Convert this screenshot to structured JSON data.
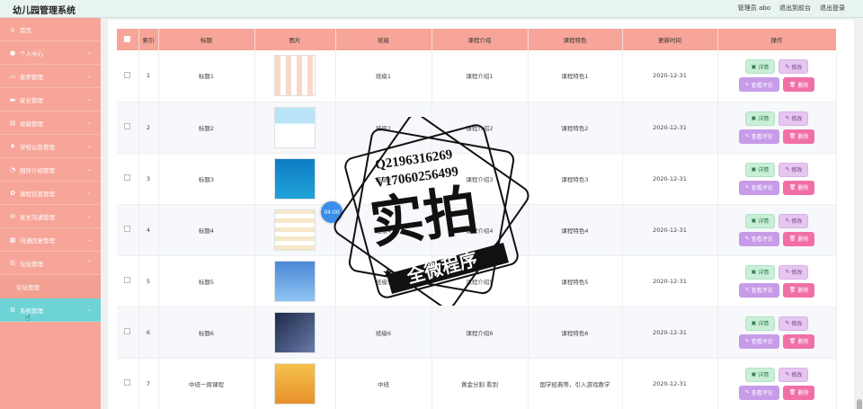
{
  "app": {
    "title": "幼儿园管理系统"
  },
  "topnav": {
    "admin": "管理员 abo",
    "front": "退出到前台",
    "logout": "退出登录"
  },
  "sidebar": {
    "items": [
      {
        "label": "首页",
        "icon": "home-icon"
      },
      {
        "label": "个人中心",
        "icon": "user-icon"
      },
      {
        "label": "老师管理",
        "icon": "chat-icon"
      },
      {
        "label": "家长管理",
        "icon": "monitor-icon"
      },
      {
        "label": "班级管理",
        "icon": "folder-icon"
      },
      {
        "label": "学校公告管理",
        "icon": "bell-icon"
      },
      {
        "label": "园所介绍管理",
        "icon": "clock-icon"
      },
      {
        "label": "课程信息管理",
        "icon": "gear-icon"
      },
      {
        "label": "家长沟通管理",
        "icon": "mail-icon"
      },
      {
        "label": "沟通回复管理",
        "icon": "doc-icon"
      },
      {
        "label": "论坛管理",
        "icon": "forum-icon"
      }
    ],
    "submenu": "论坛管理",
    "active": {
      "label": "系统管理",
      "icon": "gear-icon"
    }
  },
  "table": {
    "columns": [
      "索引",
      "标题",
      "图片",
      "班级",
      "课程介绍",
      "课程特色",
      "更新时间",
      "操作"
    ],
    "rows": [
      {
        "index": "1",
        "title": "标题1",
        "cls": "班级1",
        "intro": "课程介绍1",
        "feature": "课程特色1",
        "time": "2020-12-31",
        "img": "img1"
      },
      {
        "index": "2",
        "title": "标题2",
        "cls": "班级2",
        "intro": "课程介绍2",
        "feature": "课程特色2",
        "time": "2020-12-31",
        "img": "img2"
      },
      {
        "index": "3",
        "title": "标题3",
        "cls": "班级3",
        "intro": "课程介绍3",
        "feature": "课程特色3",
        "time": "2020-12-31",
        "img": "img3"
      },
      {
        "index": "4",
        "title": "标题4",
        "cls": "班级4",
        "intro": "课程介绍4",
        "feature": "课程特色4",
        "time": "2020-12-31",
        "img": "img4"
      },
      {
        "index": "5",
        "title": "标题5",
        "cls": "班级5",
        "intro": "课程介绍5",
        "feature": "课程特色5",
        "time": "2020-12-31",
        "img": "img5"
      },
      {
        "index": "6",
        "title": "标题6",
        "cls": "班级6",
        "intro": "课程介绍6",
        "feature": "课程特色6",
        "time": "2020-12-31",
        "img": "img6"
      },
      {
        "index": "7",
        "title": "中班一周课程",
        "cls": "中班",
        "intro": "黄金分割 看到",
        "feature": "国学经典等，引入游戏教学",
        "time": "2020-12-31",
        "img": "img7"
      }
    ],
    "buttons": {
      "detail": "详情",
      "edit": "修改",
      "review": "查看评论",
      "delete": "删除"
    }
  },
  "overlay": {
    "time": "04:00"
  },
  "watermark": {
    "line1": "Q2196316269",
    "line2": "V17060256499",
    "big": "实拍",
    "banner": "全微程序"
  },
  "colors": {
    "sidebar": "#f7a598",
    "active": "#6dd3d5",
    "header_row": "#f7a598"
  }
}
